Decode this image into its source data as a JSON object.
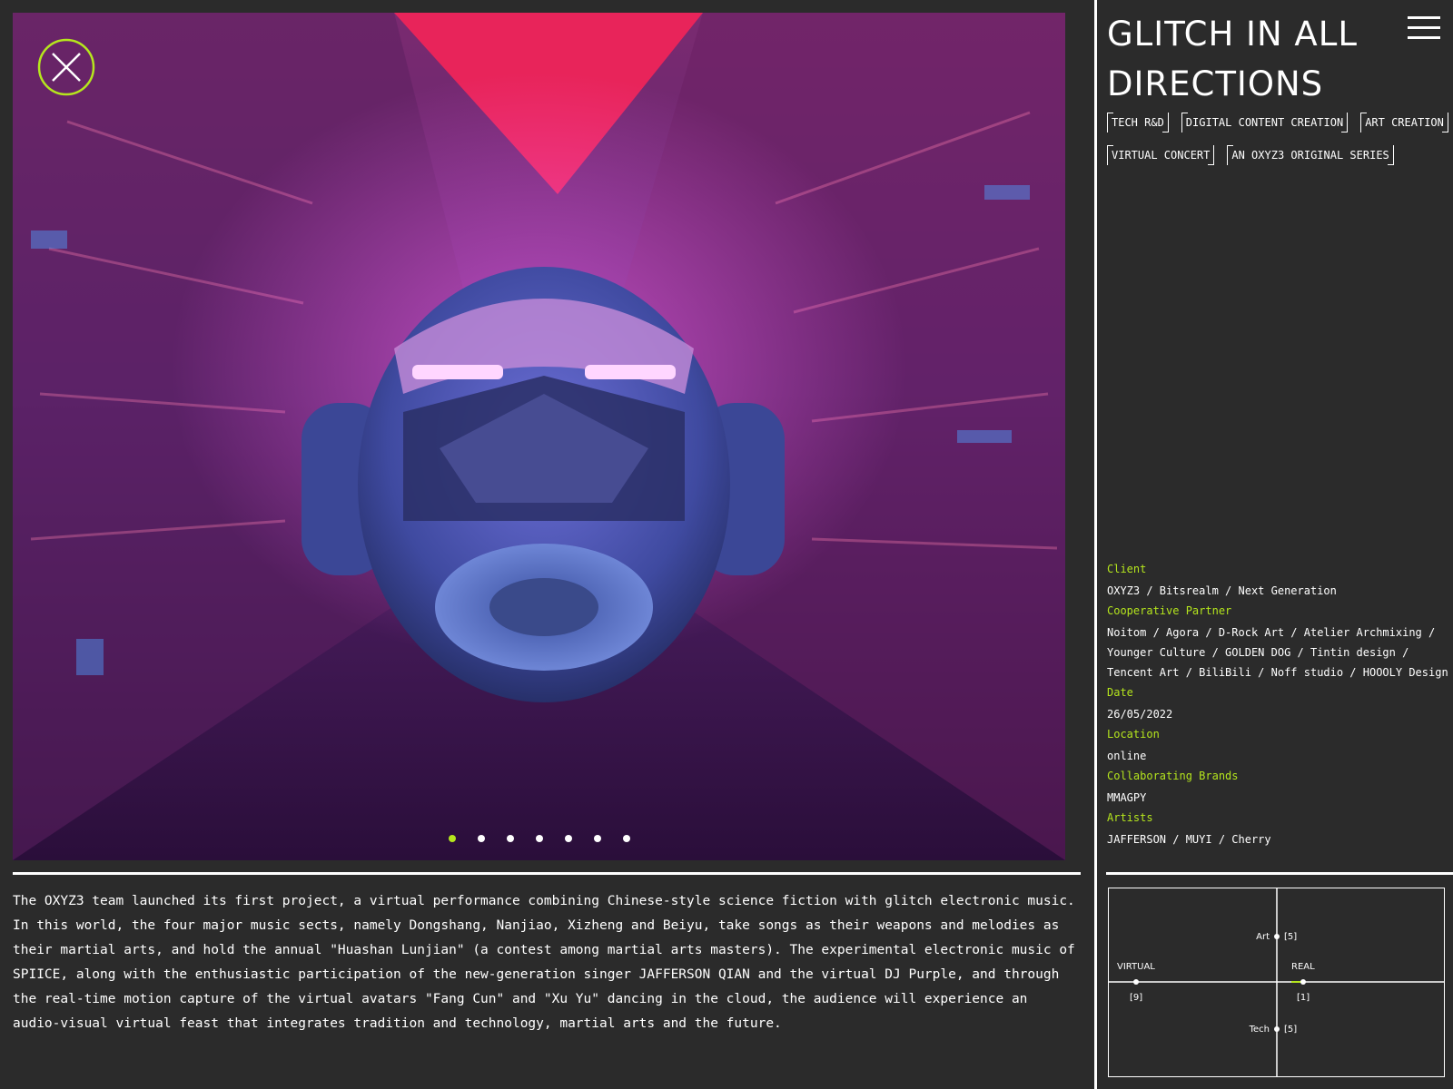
{
  "project": {
    "title": "GLITCH IN ALL DIRECTIONS",
    "tags": [
      "TECH R&D",
      "DIGITAL CONTENT CREATION",
      "ART CREATION",
      "VIRTUAL CONCERT",
      "AN OXYZ3 ORIGINAL SERIES"
    ]
  },
  "gallery": {
    "slide_count": 7,
    "active_slide": 1
  },
  "meta": [
    {
      "label": "Client",
      "value": "OXYZ3 / Bitsrealm / Next Generation"
    },
    {
      "label": "Cooperative Partner",
      "value": "Noitom / Agora / D-Rock Art / Atelier Archmixing / Younger Culture / GOLDEN DOG / Tintin design / Tencent Art / BiliBili / Noff studio / HOOOLY Design"
    },
    {
      "label": "Date",
      "value": "26/05/2022"
    },
    {
      "label": "Location",
      "value": "online"
    },
    {
      "label": "Collaborating Brands",
      "value": "MMAGPY"
    },
    {
      "label": "Artists",
      "value": "JAFFERSON / MUYI / Cherry"
    }
  ],
  "description": "The OXYZ3 team launched its first project, a virtual performance combining Chinese-style science fiction with glitch electronic music. In this world, the four major music sects, namely Dongshang, Nanjiao, Xizheng and Beiyu, take songs as their weapons and melodies as their martial arts, and hold the annual \"Huashan Lunjian\" (a contest among martial arts masters). The experimental electronic music of SPIICE, along with the enthusiastic participation of the new-generation singer JAFFERSON QIAN and the virtual DJ Purple, and through the real-time motion capture of the virtual avatars \"Fang Cun\" and \"Xu Yu\" dancing in the cloud, the audience will experience an audio-visual virtual feast that integrates tradition and technology, martial arts and the future.",
  "quadrant": {
    "art": {
      "label": "Art",
      "count": "[5]"
    },
    "tech": {
      "label": "Tech",
      "count": "[5]"
    },
    "virtual": {
      "label": "VIRTUAL",
      "count": "[9]"
    },
    "real": {
      "label": "REAL",
      "count": "[1]"
    }
  },
  "colors": {
    "accent": "#b5e61d",
    "background": "#2b2b2b",
    "text": "#ffffff"
  },
  "icons": {
    "close": "close-x-circle-icon",
    "menu": "hamburger-menu-icon"
  }
}
